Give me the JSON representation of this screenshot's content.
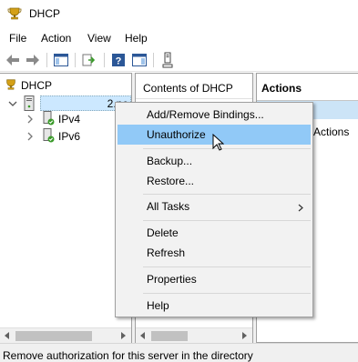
{
  "window": {
    "title": "DHCP",
    "app_icon": "dhcp-trophy-icon"
  },
  "menubar": {
    "items": [
      "File",
      "Action",
      "View",
      "Help"
    ]
  },
  "toolbar": {
    "buttons": [
      "back-arrow-icon",
      "forward-arrow-icon",
      "show-hide-console-tree-icon",
      "export-list-icon",
      "help-icon",
      "show-hide-action-pane-icon",
      "authorize-server-icon"
    ]
  },
  "tree": {
    "root": "DHCP",
    "server_suffix": "2.ne",
    "children": [
      "IPv4",
      "IPv6"
    ]
  },
  "contents": {
    "header": "Contents of DHCP"
  },
  "actions": {
    "header": "Actions",
    "more_label": "Actions"
  },
  "context_menu": {
    "items": [
      {
        "label": "Add/Remove Bindings...",
        "highlighted": false
      },
      {
        "label": "Unauthorize",
        "highlighted": true
      },
      {
        "label": "Backup..."
      },
      {
        "label": "Restore..."
      },
      {
        "label": "All Tasks",
        "submenu": true
      },
      {
        "label": "Delete"
      },
      {
        "label": "Refresh"
      },
      {
        "label": "Properties"
      },
      {
        "label": "Help"
      }
    ]
  },
  "status": {
    "text": "Remove authorization for this server in the directory"
  },
  "colors": {
    "selection": "#cce8ff",
    "menu_highlight": "#91c9f7",
    "panel_bg": "#f0f0f0"
  }
}
